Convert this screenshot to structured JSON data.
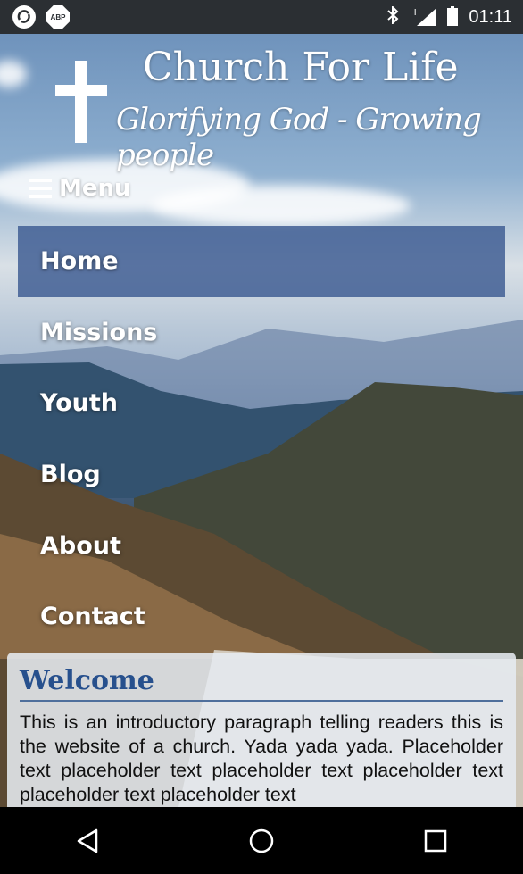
{
  "status_bar": {
    "time": "01:11",
    "left_icons": [
      "sync-icon",
      "abp-icon"
    ],
    "abp_label": "ABP",
    "right_icons": [
      "bluetooth-icon",
      "signal-icon",
      "battery-icon"
    ],
    "signal_label": "H"
  },
  "header": {
    "title": "Church For Life",
    "tagline": "Glorifying God - Growing people"
  },
  "menu": {
    "toggle_label": "Menu",
    "items": [
      {
        "label": "Home",
        "active": true
      },
      {
        "label": "Missions",
        "active": false
      },
      {
        "label": "Youth",
        "active": false
      },
      {
        "label": "Blog",
        "active": false
      },
      {
        "label": "About",
        "active": false
      },
      {
        "label": "Contact",
        "active": false
      }
    ]
  },
  "welcome": {
    "title": "Welcome",
    "text": "This is an introductory paragraph telling readers this is the website of a church. Yada yada yada. Placeholder text placeholder text placeholder text placeholder text placeholder text placeholder text"
  },
  "colors": {
    "active_nav": "#3c5a91",
    "welcome_title": "#27508d"
  }
}
